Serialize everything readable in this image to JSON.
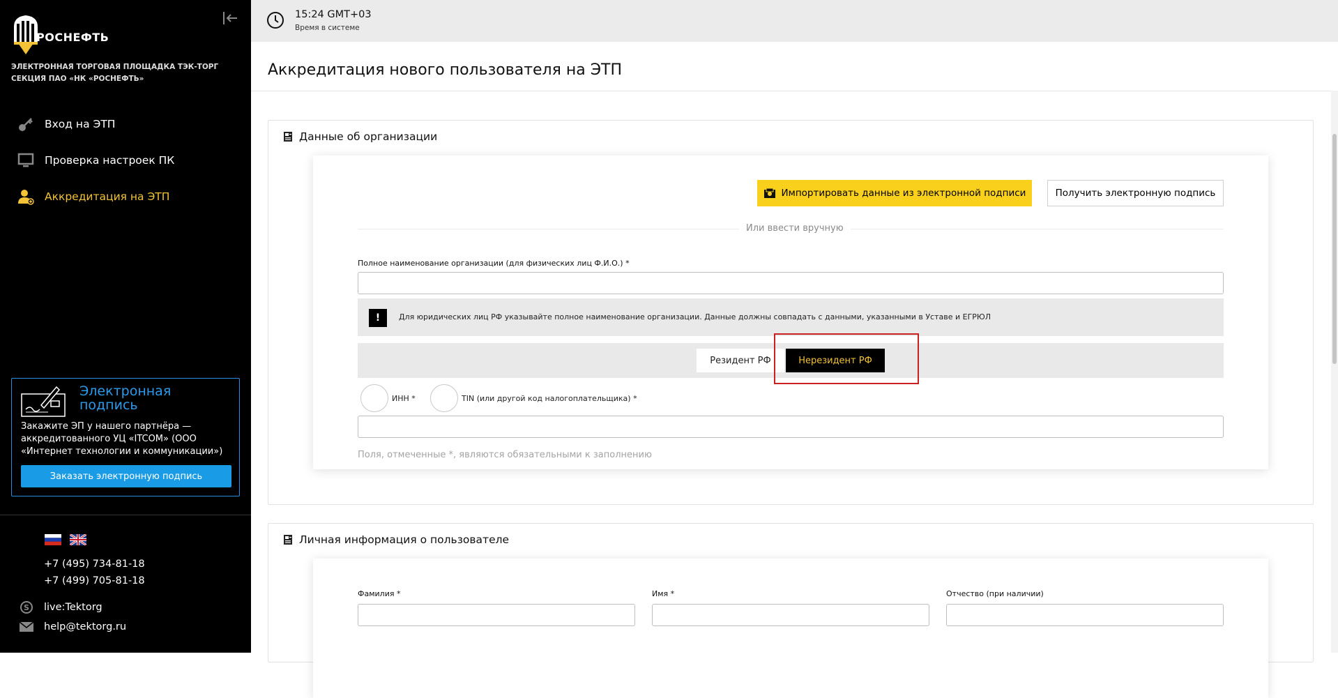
{
  "sidebar": {
    "logo_text": "РОСНЕФТЬ",
    "platform_desc": "ЭЛЕКТРОННАЯ ТОРГОВАЯ ПЛОЩАДКА ТЭК-ТОРГ СЕКЦИЯ ПАО «НК «РОСНЕФТЬ»",
    "nav": [
      {
        "label": "Вход на ЭТП",
        "icon": "key-icon",
        "active": false
      },
      {
        "label": "Проверка настроек ПК",
        "icon": "monitor-icon",
        "active": false
      },
      {
        "label": "Аккредитация на ЭТП",
        "icon": "user-add-icon",
        "active": true
      }
    ],
    "ep_card": {
      "title": "Электронная подпись",
      "text": "Закажите ЭП у нашего партнёра — аккредитованного УЦ «ITCOM» (ООО «Интернет технологии и коммуникации»)",
      "button": "Заказать электронную подпись"
    },
    "phones": [
      "+7 (495) 734-81-18",
      "+7 (499) 705-81-18"
    ],
    "skype": "live:Tektorg",
    "email": "help@tektorg.ru"
  },
  "topbar": {
    "time": "15:24 GMT+03",
    "time_sub": "Время в системе"
  },
  "page_title": "Аккредитация нового пользователя на ЭТП",
  "org_section": {
    "title": "Данные об организации",
    "import_button": "Импортировать данные из электронной подписи",
    "get_signature_button": "Получить электронную подпись",
    "or_text": "Или ввести вручную",
    "full_name_label": "Полное наименование организации (для физических лиц Ф.И.О.)",
    "full_name_value": "",
    "hint": "Для юридических лиц РФ указывайте полное наименование организации. Данные должны совпадать с данными, указанными в Уставе и ЕГРЮЛ",
    "resident_label": "Резидент РФ",
    "nonresident_label": "Нерезидент РФ",
    "selected": "nonresident",
    "radio_inn": "ИНН *",
    "radio_tin": "TIN (или другой код налогоплательщика) *",
    "tax_value": "",
    "required_note": "Поля, отмеченные *, являются обязательными к заполнению"
  },
  "personal_section": {
    "title": "Личная информация о пользователе",
    "last_name_label": "Фамилия",
    "first_name_label": "Имя",
    "middle_name_label": "Отчество (при наличии)",
    "last_name_value": "",
    "first_name_value": "",
    "middle_name_value": ""
  },
  "colors": {
    "accent_yellow": "#f9d11d",
    "active_nav": "#f3c237",
    "ep_blue": "#1a9be6",
    "highlight_red": "#cc1f1f"
  }
}
